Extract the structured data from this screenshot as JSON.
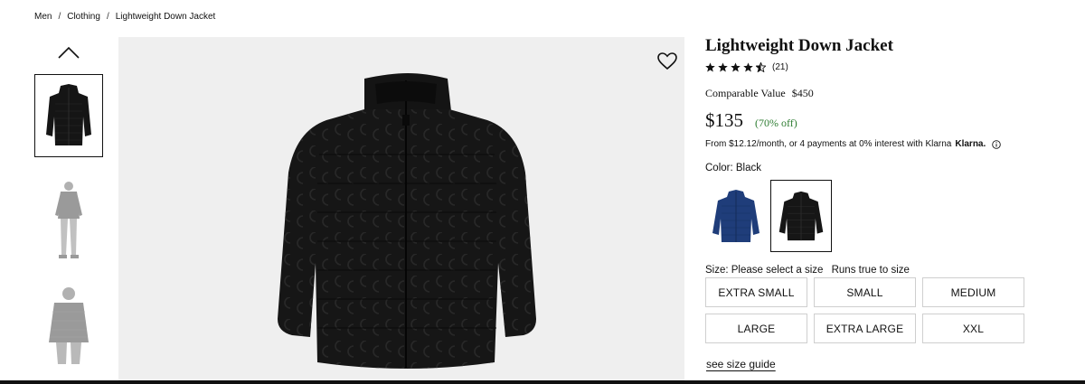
{
  "breadcrumb": {
    "items": [
      "Men",
      "Clothing",
      "Lightweight Down Jacket"
    ],
    "separator": "/"
  },
  "gallery": {
    "thumbnails": [
      "jacket-front",
      "model-full-body",
      "model-back"
    ],
    "selected_index": 0,
    "up_icon": "chevron-up-icon",
    "favorite_icon": "heart-icon"
  },
  "product": {
    "title": "Lightweight Down Jacket",
    "rating": 4.5,
    "rating_max": 5,
    "review_count": "(21)",
    "comparable_label": "Comparable Value",
    "comparable_value": "$450",
    "price": "$135",
    "discount": "(70% off)",
    "klarna_text": "From $12.12/month, or 4 payments at 0% interest with Klarna",
    "klarna_brand": "Klarna.",
    "color_label": "Color: Black",
    "colors": [
      "navy",
      "black"
    ],
    "selected_color_index": 1,
    "size_label": "Size: Please select a size",
    "size_hint": "Runs true to size",
    "sizes": [
      "EXTRA SMALL",
      "SMALL",
      "MEDIUM",
      "LARGE",
      "EXTRA LARGE",
      "XXL"
    ],
    "size_guide": "see size guide"
  },
  "colors": {
    "discount": "#2e7d32",
    "jacket_black": "#1a1a1a",
    "jacket_navy": "#1f3d7a",
    "image_bg": "#efefef"
  }
}
